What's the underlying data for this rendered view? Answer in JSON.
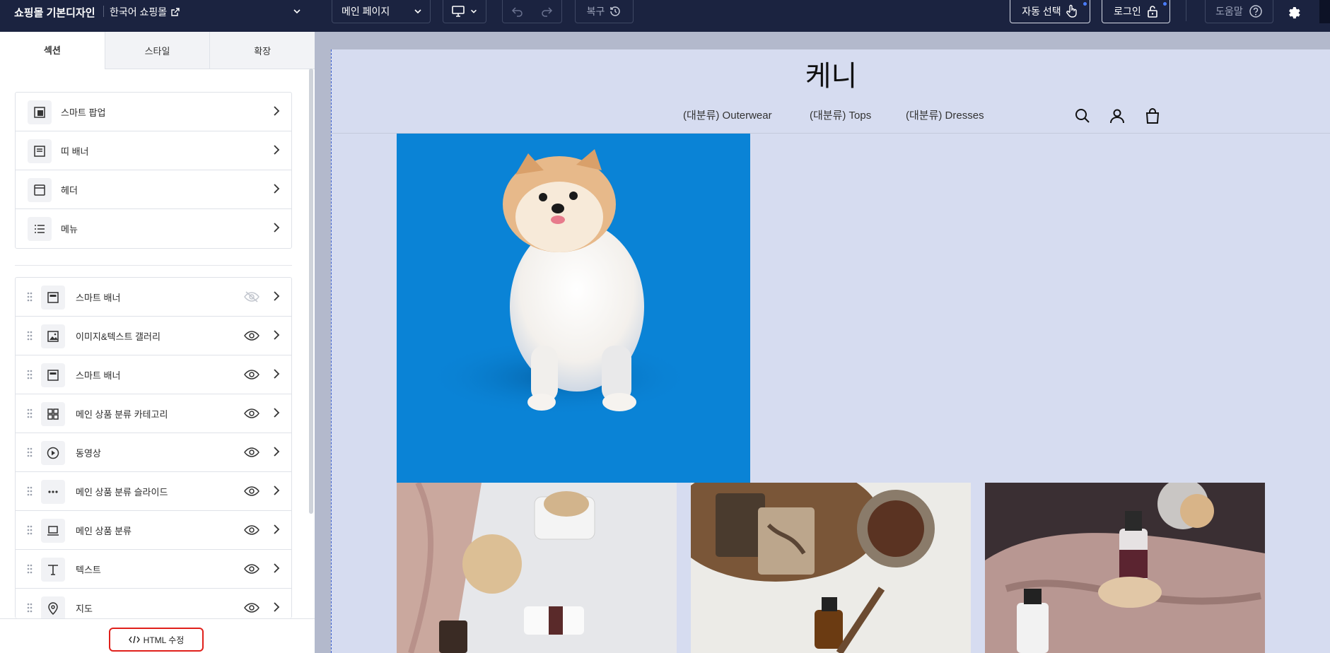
{
  "topbar": {
    "shop_title": "쇼핑몰 기본디자인",
    "language": "한국어 쇼핑몰",
    "page_select": "메인 페이지",
    "restore_label": "복구",
    "auto_select_label": "자동 선택",
    "login_label": "로그인",
    "help_label": "도움말"
  },
  "sidebar": {
    "tabs": [
      {
        "label": "섹션"
      },
      {
        "label": "스타일"
      },
      {
        "label": "확장"
      }
    ],
    "fixed_items": [
      {
        "label": "스마트 팝업",
        "icon": "popup-icon"
      },
      {
        "label": "띠 배너",
        "icon": "strip-banner-icon"
      },
      {
        "label": "헤더",
        "icon": "header-icon"
      },
      {
        "label": "메뉴",
        "icon": "menu-list-icon"
      }
    ],
    "sections": [
      {
        "label": "스마트 배너",
        "icon": "banner-icon",
        "visible": false
      },
      {
        "label": "이미지&텍스트 갤러리",
        "icon": "image-icon",
        "visible": true
      },
      {
        "label": "스마트 배너",
        "icon": "banner-icon",
        "visible": true
      },
      {
        "label": "메인 상품 분류 카테고리",
        "icon": "grid-icon",
        "visible": true
      },
      {
        "label": "동영상",
        "icon": "play-icon",
        "visible": true
      },
      {
        "label": "메인 상품 분류 슬라이드",
        "icon": "dots-icon",
        "visible": true
      },
      {
        "label": "메인 상품 분류",
        "icon": "laptop-icon",
        "visible": true
      },
      {
        "label": "텍스트",
        "icon": "text-icon",
        "visible": true
      },
      {
        "label": "지도",
        "icon": "map-pin-icon",
        "visible": true
      }
    ],
    "html_edit_label": "HTML 수정"
  },
  "preview": {
    "store_title": "케니",
    "nav": [
      "(대분류) Outerwear",
      "(대분류) Tops",
      "(대분류) Dresses"
    ]
  },
  "colors": {
    "topbar_bg": "#1b2340",
    "preview_bg": "#d6dcf0",
    "dog_bg": "#0a83d6",
    "highlight": "#e0201b"
  }
}
